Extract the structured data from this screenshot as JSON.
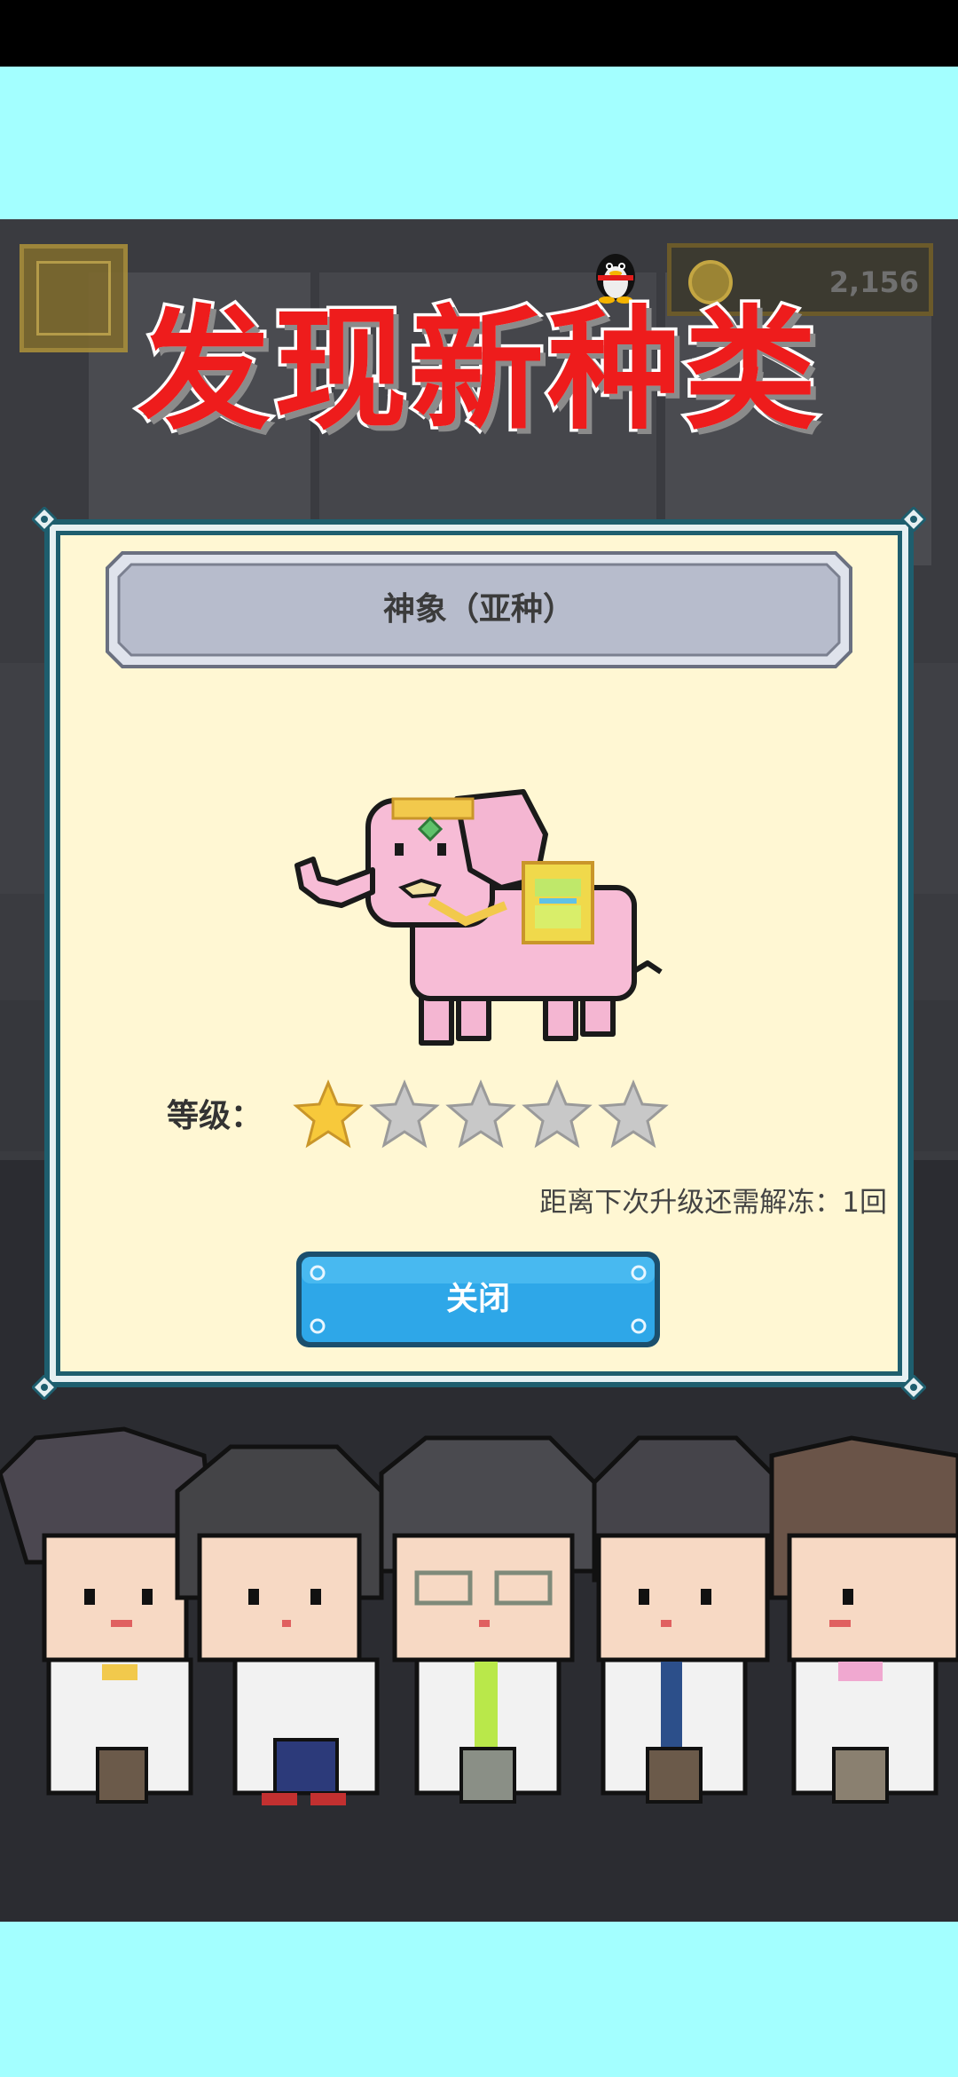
{
  "hud": {
    "coin_count": "2,156",
    "coin_icon": "coin-icon",
    "menu_icon": "menu-box-icon",
    "qq_icon": "penguin-icon"
  },
  "banner": {
    "title": "发现新种类",
    "color": "#ee1c1c"
  },
  "dialog": {
    "species_name": "神象（亚种）",
    "creature_icon": "pink-elephant-sprite",
    "level_label": "等级：",
    "level": {
      "filled": 1,
      "total": 5
    },
    "upgrade_hint": "距离下次升级还需解冻：1回",
    "close_button_label": "关闭",
    "colors": {
      "panel": "#fff7d3",
      "frame": "#1e5e6e",
      "button": "#2ea7e8",
      "star_filled": "#f7c93b",
      "star_empty": "#c8c8c8"
    }
  },
  "characters": [
    "scientist-1",
    "scientist-2",
    "scientist-3",
    "scientist-4",
    "scientist-5"
  ]
}
